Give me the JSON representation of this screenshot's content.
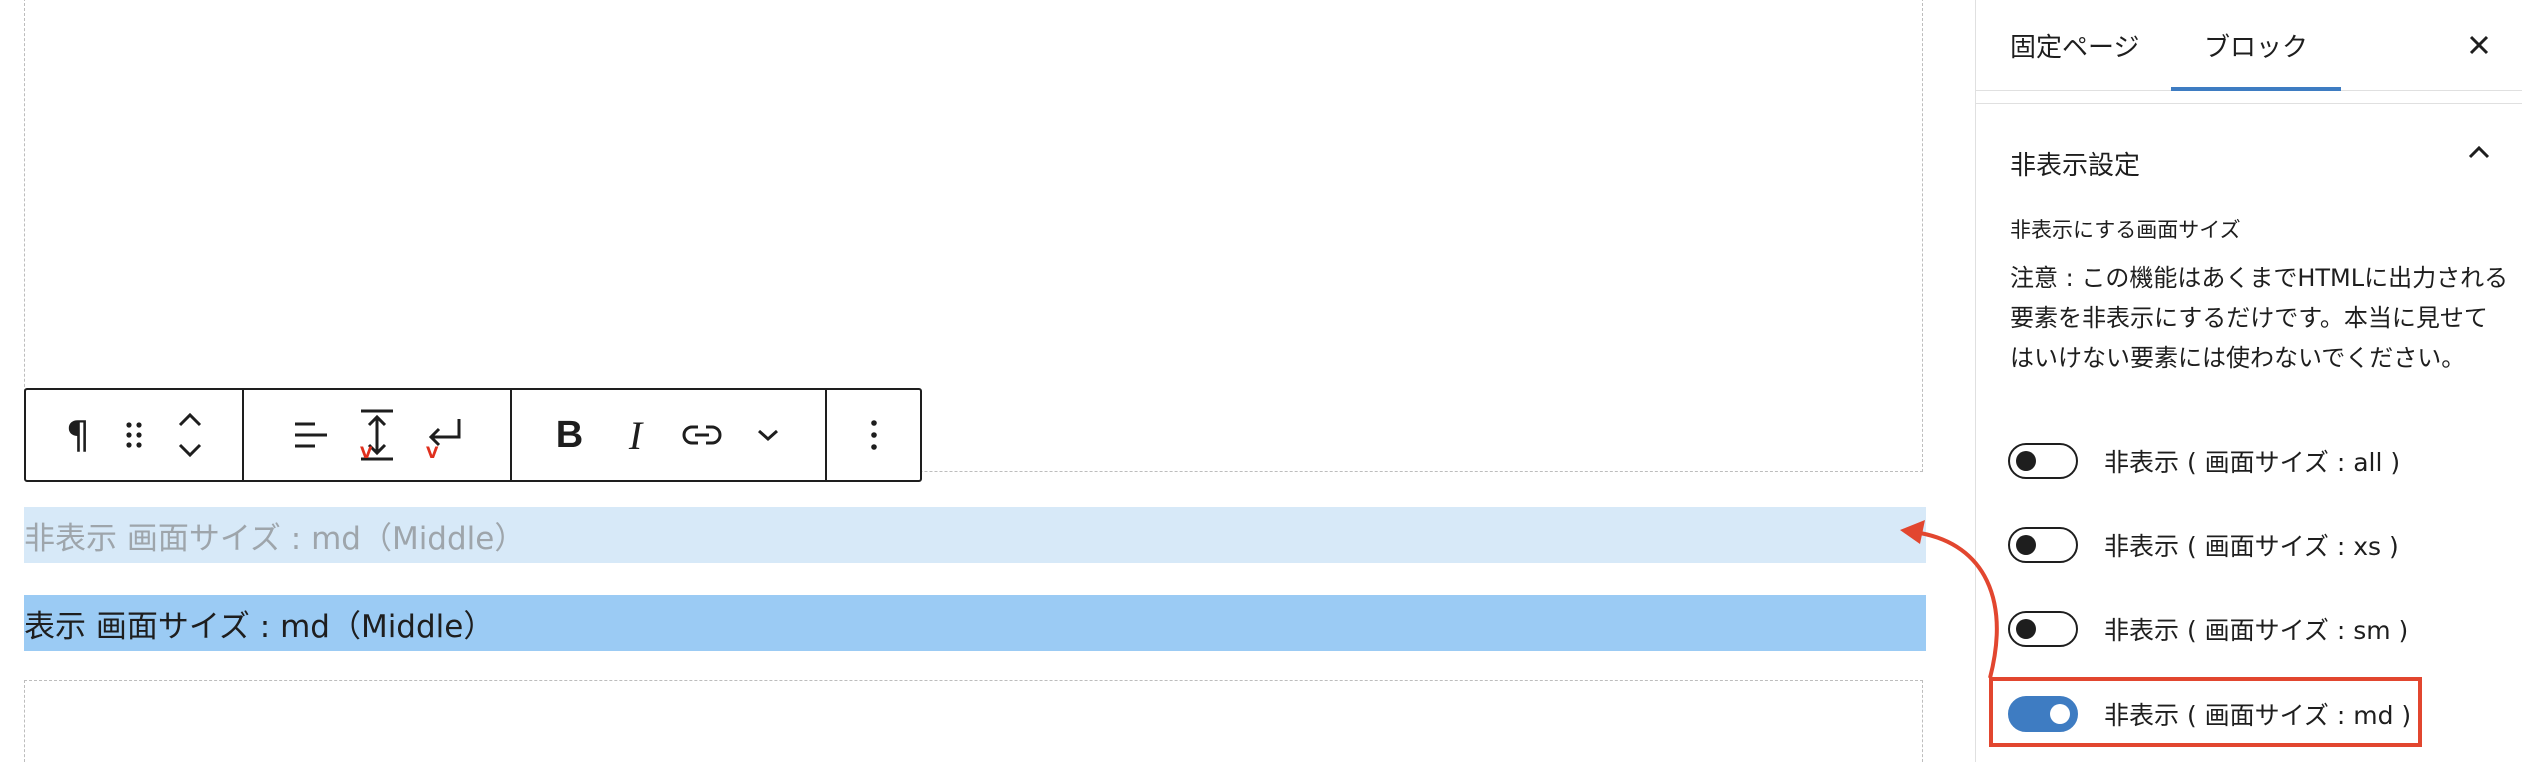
{
  "editor": {
    "hidden_paragraph": "非表示 画面サイズ : md（Middle）",
    "visible_paragraph": "表示 画面サイズ : md（Middle）"
  },
  "toolbar": {
    "paragraph_symbol": "¶",
    "bold_label": "B",
    "italic_label": "I"
  },
  "sidebar": {
    "tabs": [
      {
        "label": "固定ページ",
        "active": false
      },
      {
        "label": "ブロック",
        "active": true
      }
    ],
    "panel_title": "非表示設定",
    "field_label": "非表示にする画面サイズ",
    "note": "注意 : この機能はあくまでHTMLに出力される要素を非表示にするだけです。本当に見せてはいけない要素には使わないでください。",
    "toggles": [
      {
        "label": "非表示 ( 画面サイズ : all )",
        "checked": false
      },
      {
        "label": "非表示 ( 画面サイズ : xs )",
        "checked": false
      },
      {
        "label": "非表示 ( 画面サイズ : sm )",
        "checked": false
      },
      {
        "label": "非表示 ( 画面サイズ : md )",
        "checked": true
      }
    ]
  },
  "colors": {
    "accent": "#3e7cc2",
    "highlight": "#e2462f",
    "hidden_block_bg": "#d7e9f8",
    "visible_block_bg": "#9bcbf4"
  }
}
